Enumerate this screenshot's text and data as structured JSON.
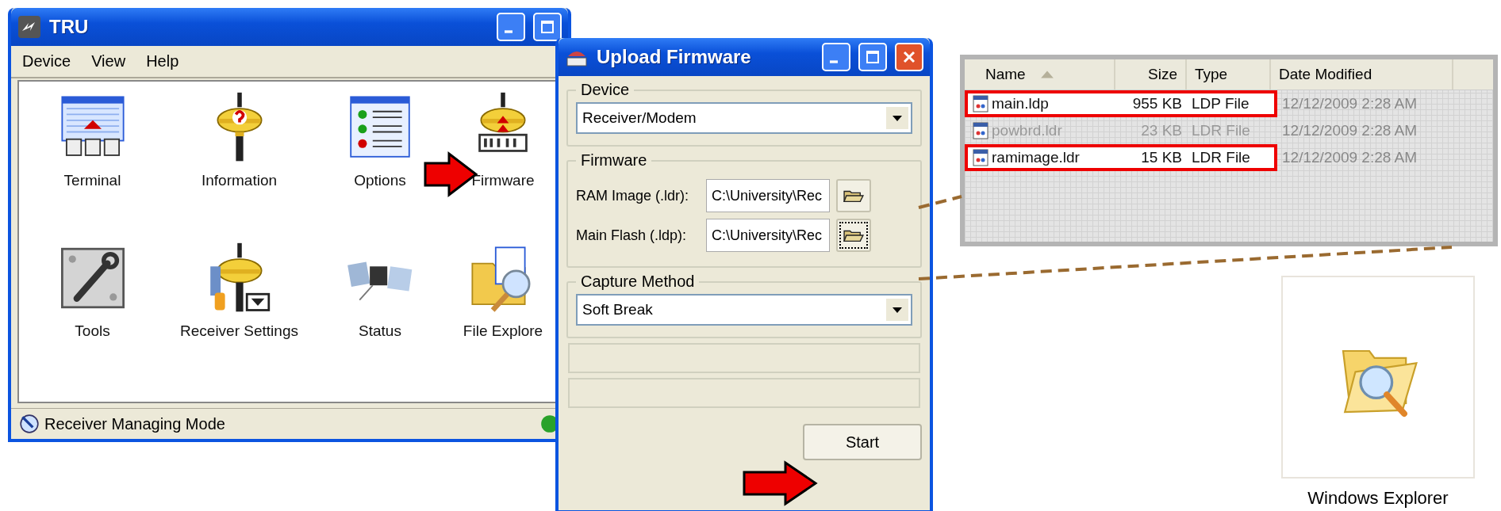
{
  "tru_window": {
    "title": "TRU",
    "menu": [
      "Device",
      "View",
      "Help"
    ],
    "icons": [
      {
        "label": "Terminal",
        "kind": "terminal"
      },
      {
        "label": "Information",
        "kind": "information"
      },
      {
        "label": "Options",
        "kind": "options"
      },
      {
        "label": "Firmware",
        "kind": "firmware"
      },
      {
        "label": "Tools",
        "kind": "tools"
      },
      {
        "label": "Receiver Settings",
        "kind": "receiver_settings"
      },
      {
        "label": "Status",
        "kind": "status"
      },
      {
        "label": "File Explore",
        "kind": "file_explorer"
      }
    ],
    "status": "Receiver Managing Mode"
  },
  "upload_window": {
    "title": "Upload Firmware",
    "device_group": {
      "label": "Device",
      "value": "Receiver/Modem"
    },
    "firmware_group": {
      "label": "Firmware",
      "fields": [
        {
          "label": "RAM Image (.ldr):",
          "value": "C:\\University\\Rec",
          "focused": false
        },
        {
          "label": "Main Flash (.ldp):",
          "value": "C:\\University\\Rec",
          "focused": true
        }
      ]
    },
    "capture_group": {
      "label": "Capture Method",
      "value": "Soft Break"
    },
    "progress_bars": [
      {
        "level": 0
      },
      {
        "level": 0
      }
    ],
    "start_button": "Start"
  },
  "file_list": {
    "columns": [
      "Name",
      "Size",
      "Type",
      "Date Modified"
    ],
    "rows": [
      {
        "name": "main.ldp",
        "size": "955 KB",
        "type": "LDP File",
        "date": "12/12/2009 2:28 AM",
        "highlighted": true
      },
      {
        "name": "powbrd.ldr",
        "size": "23 KB",
        "type": "LDR File",
        "date": "12/12/2009 2:28 AM",
        "highlighted": false
      },
      {
        "name": "ramimage.ldr",
        "size": "15 KB",
        "type": "LDR File",
        "date": "12/12/2009 2:28 AM",
        "highlighted": true
      }
    ]
  },
  "desktop_icon": {
    "label": "Windows Explorer"
  }
}
